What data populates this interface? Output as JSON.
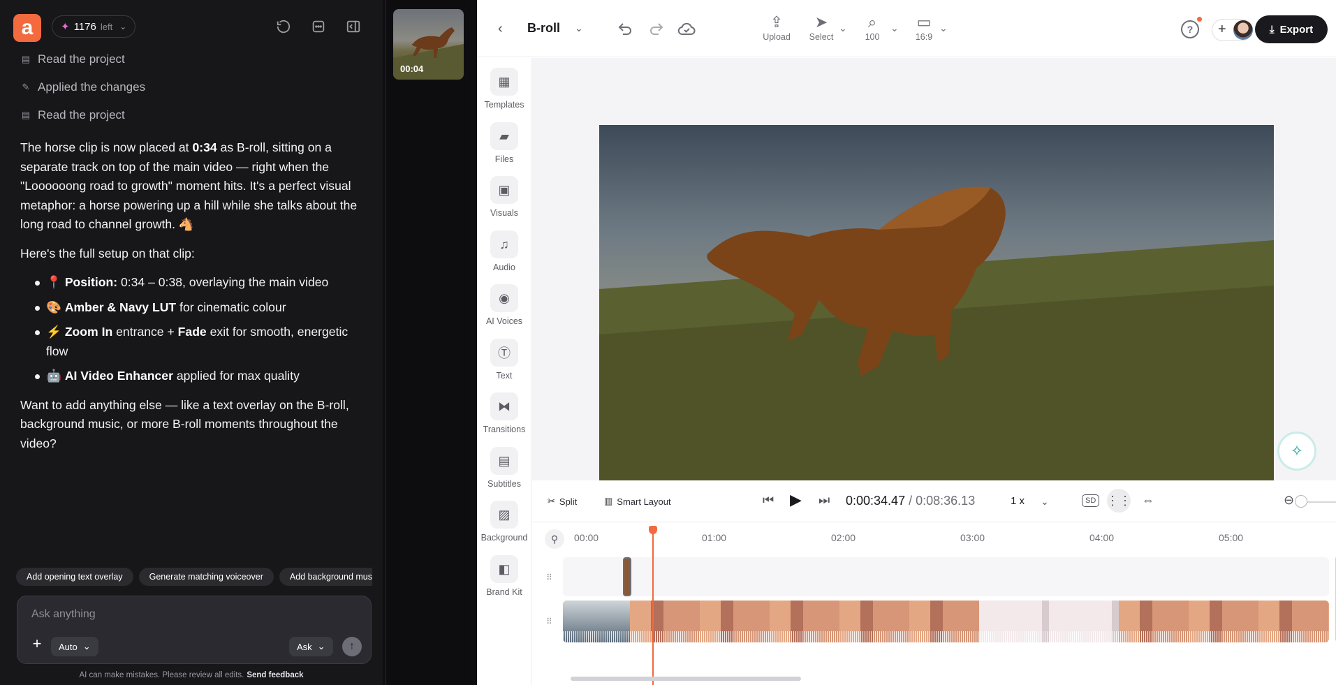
{
  "chat": {
    "credits_count": "1176",
    "credits_suffix": "left",
    "steps": [
      "Read the project",
      "Applied the changes",
      "Read the project"
    ],
    "message": {
      "p1_prefix": "The horse clip is now placed at ",
      "p1_time": "0:34",
      "p1_suffix": " as B-roll, sitting on a separate track on top of the main video — right when the \"Loooooong road to growth\" moment hits. It's a perfect visual metaphor: a horse powering up a hill while she talks about the long road to channel growth. 🐴",
      "p2": "Here's the full setup on that clip:",
      "bullets": [
        {
          "emoji": "📍",
          "bold": "Position:",
          "text": " 0:34 – 0:38, overlaying the main video"
        },
        {
          "emoji": "🎨",
          "bold": "Amber & Navy LUT",
          "text": " for cinematic colour"
        },
        {
          "emoji": "⚡",
          "bold": "Zoom In",
          "text": " entrance + ",
          "bold2": "Fade",
          "text2": " exit for smooth, energetic flow"
        },
        {
          "emoji": "🤖",
          "bold": "AI Video Enhancer",
          "text": " applied for max quality"
        }
      ],
      "p3": "Want to add anything else — like a text overlay on the B-roll, background music, or more B-roll moments throughout the video?"
    },
    "suggestions": [
      "Add opening text overlay",
      "Generate matching voiceover",
      "Add background music"
    ],
    "input_placeholder": "Ask anything",
    "mode_label": "Auto",
    "ask_label": "Ask",
    "disclaimer": "AI can make mistakes. Please review all edits.",
    "feedback_link": "Send feedback"
  },
  "thumb": {
    "time": "00:04"
  },
  "editor": {
    "project_name": "B-roll",
    "tools": {
      "upload": "Upload",
      "select": "Select",
      "zoom": "100",
      "ratio": "16:9"
    },
    "export_label": "Export",
    "rail": [
      "Templates",
      "Files",
      "Visuals",
      "Audio",
      "AI Voices",
      "Text",
      "Transitions",
      "Subtitles",
      "Background",
      "Brand Kit"
    ],
    "transport": {
      "split": "Split",
      "smart_layout": "Smart Layout",
      "current_time": "0:00:34.47",
      "separator": "/",
      "total_time": "0:08:36.13",
      "speed": "1 x",
      "quality": "SD"
    },
    "ruler": [
      "00:00",
      "01:00",
      "02:00",
      "03:00",
      "04:00",
      "05:00"
    ]
  },
  "colors": {
    "accent": "#f26a3d",
    "ai": "#19a89b",
    "dark": "#1a1a1e"
  }
}
